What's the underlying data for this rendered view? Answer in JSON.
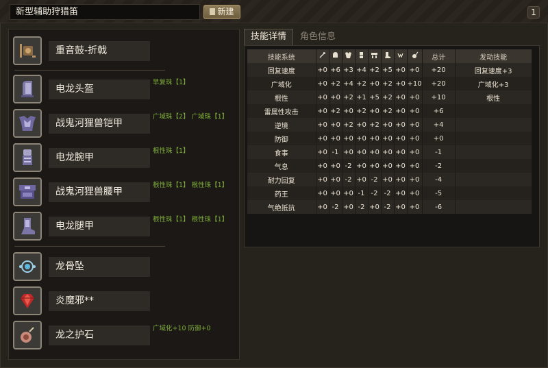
{
  "header": {
    "title": "新型辅助狩猎笛",
    "new_label": "新建",
    "page": "1"
  },
  "equipment": [
    {
      "name": "重音鼓-折戟",
      "decorations": "",
      "icon": "hunting-horn-icon"
    },
    {
      "name": "电龙头盔",
      "decorations": "早复珠【1】",
      "icon": "helmet-icon"
    },
    {
      "name": "战鬼河狸兽铠甲",
      "decorations": "广域珠【2】 广域珠【1】",
      "icon": "chest-armor-icon"
    },
    {
      "name": "电龙腕甲",
      "decorations": "根性珠【1】",
      "icon": "gauntlet-icon"
    },
    {
      "name": "战鬼河狸兽腰甲",
      "decorations": "根性珠【1】 根性珠【1】",
      "icon": "waist-armor-icon"
    },
    {
      "name": "电龙腿甲",
      "decorations": "根性珠【1】 根性珠【1】",
      "icon": "leg-armor-icon"
    },
    {
      "name": "龙骨坠",
      "decorations": "",
      "icon": "pendant-icon"
    },
    {
      "name": "炎魔邪**",
      "decorations": "",
      "icon": "gem-icon"
    },
    {
      "name": "龙之护石",
      "decorations": "广域化+10 防御+0",
      "icon": "talisman-icon"
    }
  ],
  "tabs": {
    "active": "技能详情",
    "inactive": "角色信息"
  },
  "table": {
    "headers": {
      "skill": "技能系统",
      "total": "总计",
      "activated": "发动技能"
    },
    "column_icons": [
      "weapon-icon",
      "head-icon",
      "chest-icon",
      "arm-icon",
      "waist-icon",
      "leg-icon",
      "talisman-icon",
      "charm-icon"
    ],
    "rows": [
      {
        "skill": "回复速度",
        "values": [
          "+0",
          "+6",
          "+3",
          "+4",
          "+2",
          "+5",
          "+0",
          "+0"
        ],
        "total": "+20",
        "activated": "回复速度+3"
      },
      {
        "skill": "广域化",
        "values": [
          "+0",
          "+2",
          "+4",
          "+2",
          "+0",
          "+2",
          "+0",
          "+10"
        ],
        "total": "+20",
        "activated": "广域化+3"
      },
      {
        "skill": "根性",
        "values": [
          "+0",
          "+0",
          "+2",
          "+1",
          "+5",
          "+2",
          "+0",
          "+0"
        ],
        "total": "+10",
        "activated": "根性"
      },
      {
        "skill": "雷属性攻击",
        "values": [
          "+0",
          "+2",
          "+0",
          "+2",
          "+0",
          "+2",
          "+0",
          "+0"
        ],
        "total": "+6",
        "activated": ""
      },
      {
        "skill": "逆境",
        "values": [
          "+0",
          "+0",
          "+2",
          "+0",
          "+2",
          "+0",
          "+0",
          "+0"
        ],
        "total": "+4",
        "activated": ""
      },
      {
        "skill": "防御",
        "values": [
          "+0",
          "+0",
          "+0",
          "+0",
          "+0",
          "+0",
          "+0",
          "+0"
        ],
        "total": "+0",
        "activated": ""
      },
      {
        "skill": "食事",
        "values": [
          "+0",
          "-1",
          "+0",
          "+0",
          "+0",
          "+0",
          "+0",
          "+0"
        ],
        "total": "-1",
        "activated": ""
      },
      {
        "skill": "气息",
        "values": [
          "+0",
          "+0",
          "-2",
          "+0",
          "+0",
          "+0",
          "+0",
          "+0"
        ],
        "total": "-2",
        "activated": ""
      },
      {
        "skill": "耐力回复",
        "values": [
          "+0",
          "+0",
          "-2",
          "+0",
          "-2",
          "+0",
          "+0",
          "+0"
        ],
        "total": "-4",
        "activated": ""
      },
      {
        "skill": "药王",
        "values": [
          "+0",
          "+0",
          "+0",
          "-1",
          "-2",
          "-2",
          "+0",
          "+0"
        ],
        "total": "-5",
        "activated": ""
      },
      {
        "skill": "气绝抵抗",
        "values": [
          "+0",
          "-2",
          "+0",
          "-2",
          "+0",
          "-2",
          "+0",
          "+0"
        ],
        "total": "-6",
        "activated": ""
      }
    ]
  },
  "colors": {
    "decoration_text": "#7fae3a",
    "button_gold": "#8f7d58"
  }
}
